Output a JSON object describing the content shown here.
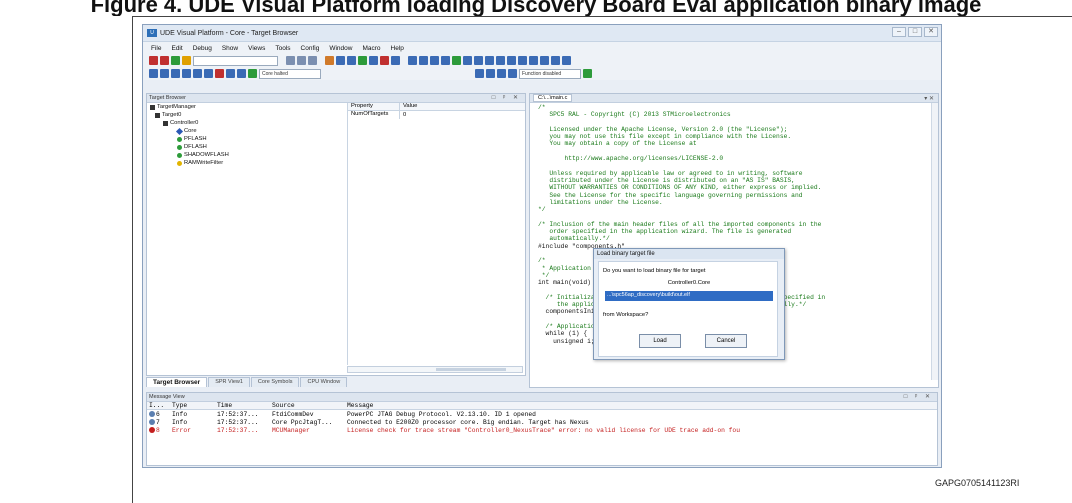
{
  "caption": {
    "title": "Figure 4. UDE Visual Platform loading Discovery Board Eval application binary image",
    "code": "GAPG0705141123RI"
  },
  "window": {
    "title": "UDE Visual Platform - Core - Target Browser",
    "controls": [
      "–",
      "□",
      "✕"
    ]
  },
  "menu": [
    "File",
    "Edit",
    "Debug",
    "Show",
    "Views",
    "Tools",
    "Config",
    "Window",
    "Macro",
    "Help"
  ],
  "toolbar": {
    "combo_state": "Core halted",
    "combo_func": "Function disabled"
  },
  "target_browser": {
    "title": "Target Browser",
    "tree": [
      "TargetManager",
      "Target0",
      "Controller0",
      "Core",
      "PFLASH",
      "DFLASH",
      "SHADOWFLASH",
      "RAMWriteFilter"
    ],
    "prop_headers": [
      "Property",
      "Value"
    ],
    "prop_rows": [
      {
        "name": "NumOfTargets",
        "value": "0"
      }
    ]
  },
  "tabs": [
    "Target Browser",
    "SPR View1",
    "Core Symbols",
    "CPU Window"
  ],
  "editor": {
    "tab": "C:\\...\\main.c",
    "lines": [
      "/*",
      "   SPC5 RAL - Copyright (C) 2013 STMicroelectronics",
      "",
      "   Licensed under the Apache License, Version 2.0 (the \"License\");",
      "   you may not use this file except in compliance with the License.",
      "   You may obtain a copy of the License at",
      "",
      "       http://www.apache.org/licenses/LICENSE-2.0",
      "",
      "   Unless required by applicable law or agreed to in writing, software",
      "   distributed under the License is distributed on an \"AS IS\" BASIS,",
      "   WITHOUT WARRANTIES OR CONDITIONS OF ANY KIND, either express or implied.",
      "   See the License for the specific language governing permissions and",
      "   limitations under the License.",
      "*/",
      "",
      "/* Inclusion of the main header files of all the imported components in the",
      "   order specified in the application wizard. The file is generated",
      "   automatically.*/",
      "#include \"components.h\"",
      "",
      "/*",
      " * Application entry point.",
      " */",
      "int main(void) {",
      "",
      "  /* Initialization of all the imported components in the order specified in",
      "     the application wizard. The function is generated automatically.*/",
      "  componentsInit();",
      "",
      "  /* Application main loop.*/",
      "  while (1) {",
      "    unsigned i;"
    ]
  },
  "dialog": {
    "title": "Load binary target file",
    "question": "Do you want to load binary file for target",
    "core": "Controller0.Core",
    "path": "...\\spc56ap_discovery\\build\\out.elf",
    "workspace": "from Workspace?",
    "load": "Load",
    "cancel": "Cancel"
  },
  "messages": {
    "title": "Message View",
    "headers": [
      "I...",
      "Type",
      "Time",
      "Source",
      "Message"
    ],
    "rows": [
      {
        "id": "6",
        "type": "Info",
        "time": "17:52:37...",
        "source": "FtdiCommDev",
        "message": "PowerPC JTAG Debug Protocol. V2.13.10. ID 1 opened",
        "level": "info"
      },
      {
        "id": "7",
        "type": "Info",
        "time": "17:52:37...",
        "source": "Core  PpcJtagT...",
        "message": "Connected to E200Z0 processor core. Big endian. Target has Nexus",
        "level": "info"
      },
      {
        "id": "8",
        "type": "Error",
        "time": "17:52:37...",
        "source": "MCUManager",
        "message": "License check for trace stream \"Controller0_NexusTrace\" error: no valid license for UDE trace add-on fou",
        "level": "error"
      }
    ]
  },
  "colors": {
    "info": "#5b7fb0",
    "error": "#c41e1e",
    "code_comment": "#1a7a1a",
    "selection": "#2f6cc4"
  }
}
